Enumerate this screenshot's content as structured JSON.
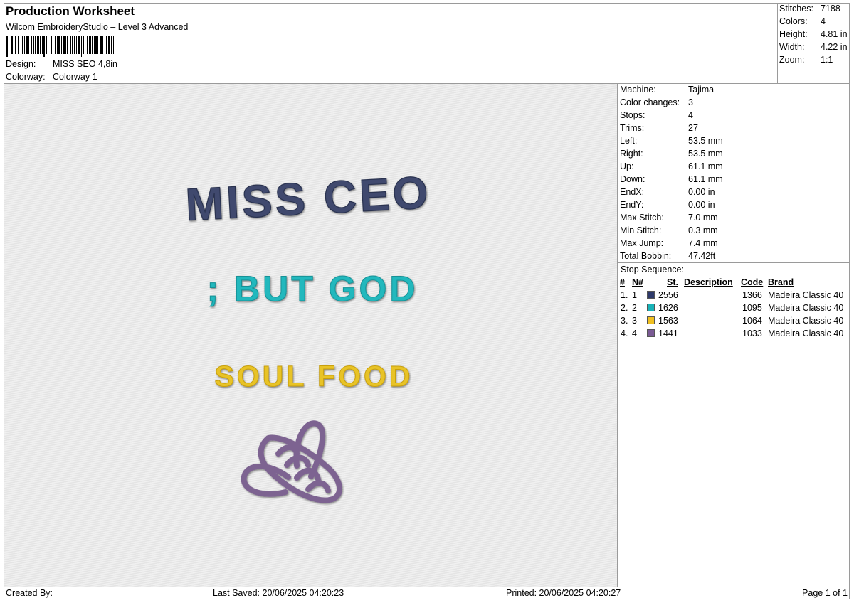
{
  "header": {
    "title": "Production Worksheet",
    "subtitle": "Wilcom EmbroideryStudio – Level 3 Advanced",
    "design_label": "Design:",
    "design_value": "MISS SEO 4,8in",
    "colorway_label": "Colorway:",
    "colorway_value": "Colorway 1"
  },
  "stats": [
    {
      "label": "Stitches:",
      "value": "7188"
    },
    {
      "label": "Colors:",
      "value": "4"
    },
    {
      "label": "Height:",
      "value": "4.81 in"
    },
    {
      "label": "Width:",
      "value": "4.22 in"
    },
    {
      "label": "Zoom:",
      "value": "1:1"
    }
  ],
  "machine_info": [
    {
      "label": "Machine:",
      "value": "Tajima"
    },
    {
      "label": "Color changes:",
      "value": "3"
    },
    {
      "label": "Stops:",
      "value": "4"
    },
    {
      "label": "Trims:",
      "value": "27"
    },
    {
      "label": "Left:",
      "value": "53.5 mm"
    },
    {
      "label": "Right:",
      "value": "53.5 mm"
    },
    {
      "label": "Up:",
      "value": "61.1 mm"
    },
    {
      "label": "Down:",
      "value": "61.1 mm"
    },
    {
      "label": "EndX:",
      "value": "0.00 in"
    },
    {
      "label": "EndY:",
      "value": "0.00 in"
    },
    {
      "label": "Max Stitch:",
      "value": "7.0 mm"
    },
    {
      "label": "Min Stitch:",
      "value": "0.3 mm"
    },
    {
      "label": "Max Jump:",
      "value": "7.4 mm"
    },
    {
      "label": "Total Bobbin:",
      "value": "47.42ft"
    }
  ],
  "stop_sequence": {
    "title": "Stop Sequence:",
    "headers": {
      "num": "#",
      "n": "N#",
      "st": "St.",
      "description": "Description",
      "code": "Code",
      "brand": "Brand"
    },
    "rows": [
      {
        "num": "1.",
        "n": "1",
        "color": "#2e3a6b",
        "st": "2556",
        "description": "",
        "code": "1366",
        "brand": "Madeira Classic 40"
      },
      {
        "num": "2.",
        "n": "2",
        "color": "#18b3b8",
        "st": "1626",
        "description": "",
        "code": "1095",
        "brand": "Madeira Classic 40"
      },
      {
        "num": "3.",
        "n": "3",
        "color": "#f0c020",
        "st": "1563",
        "description": "",
        "code": "1064",
        "brand": "Madeira Classic 40"
      },
      {
        "num": "4.",
        "n": "4",
        "color": "#7a5a94",
        "st": "1441",
        "description": "",
        "code": "1033",
        "brand": "Madeira Classic 40"
      }
    ]
  },
  "design_preview": {
    "line1": "MISS CEO",
    "line2": "; BUT GOD",
    "line3": "SOUL FOOD",
    "line1_color": "#3f4a6e",
    "line2_color": "#22b8bd",
    "line3_color": "#e8c326",
    "bee_color": "#7d6391",
    "background_color": "#e9e9e9"
  },
  "footer": {
    "created_by": "Created By:",
    "last_saved": "Last Saved: 20/06/2025 04:20:23",
    "printed": "Printed: 20/06/2025 04:20:27",
    "page": "Page 1 of 1"
  }
}
